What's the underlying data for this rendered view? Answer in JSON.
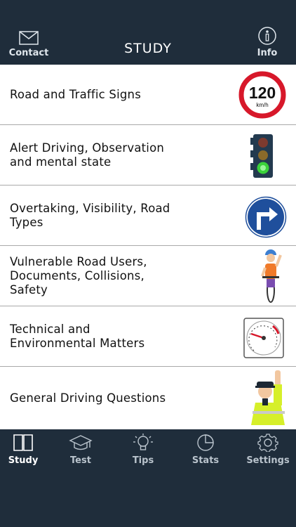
{
  "header": {
    "title": "STUDY",
    "contact_label": "Contact",
    "info_label": "Info"
  },
  "list": {
    "items": [
      {
        "label": "Road and Traffic Signs",
        "icon": "speed-limit-120-icon",
        "speed_text": "120",
        "unit_text": "km/h"
      },
      {
        "label": "Alert Driving, Observation and mental state",
        "icon": "traffic-light-icon"
      },
      {
        "label": "Overtaking, Visibility, Road Types",
        "icon": "turn-right-sign-icon"
      },
      {
        "label": "Vulnerable Road Users, Documents, Collisions, Safety",
        "icon": "cyclist-icon"
      },
      {
        "label": "Technical and Environmental Matters",
        "icon": "speedometer-icon"
      },
      {
        "label": "General Driving Questions",
        "icon": "police-officer-icon"
      }
    ]
  },
  "tabs": [
    {
      "label": "Study",
      "icon": "book-icon",
      "active": true
    },
    {
      "label": "Test",
      "icon": "graduation-cap-icon",
      "active": false
    },
    {
      "label": "Tips",
      "icon": "lightbulb-icon",
      "active": false
    },
    {
      "label": "Stats",
      "icon": "pie-chart-icon",
      "active": false
    },
    {
      "label": "Settings",
      "icon": "gear-icon",
      "active": false
    }
  ],
  "colors": {
    "bar_background": "#1f2d3b",
    "list_background": "#ffffff",
    "active_tab": "#ffffff",
    "inactive_tab": "#b9c3cc",
    "speed_sign_red": "#d7182a",
    "sign_blue": "#1f4f9c"
  }
}
